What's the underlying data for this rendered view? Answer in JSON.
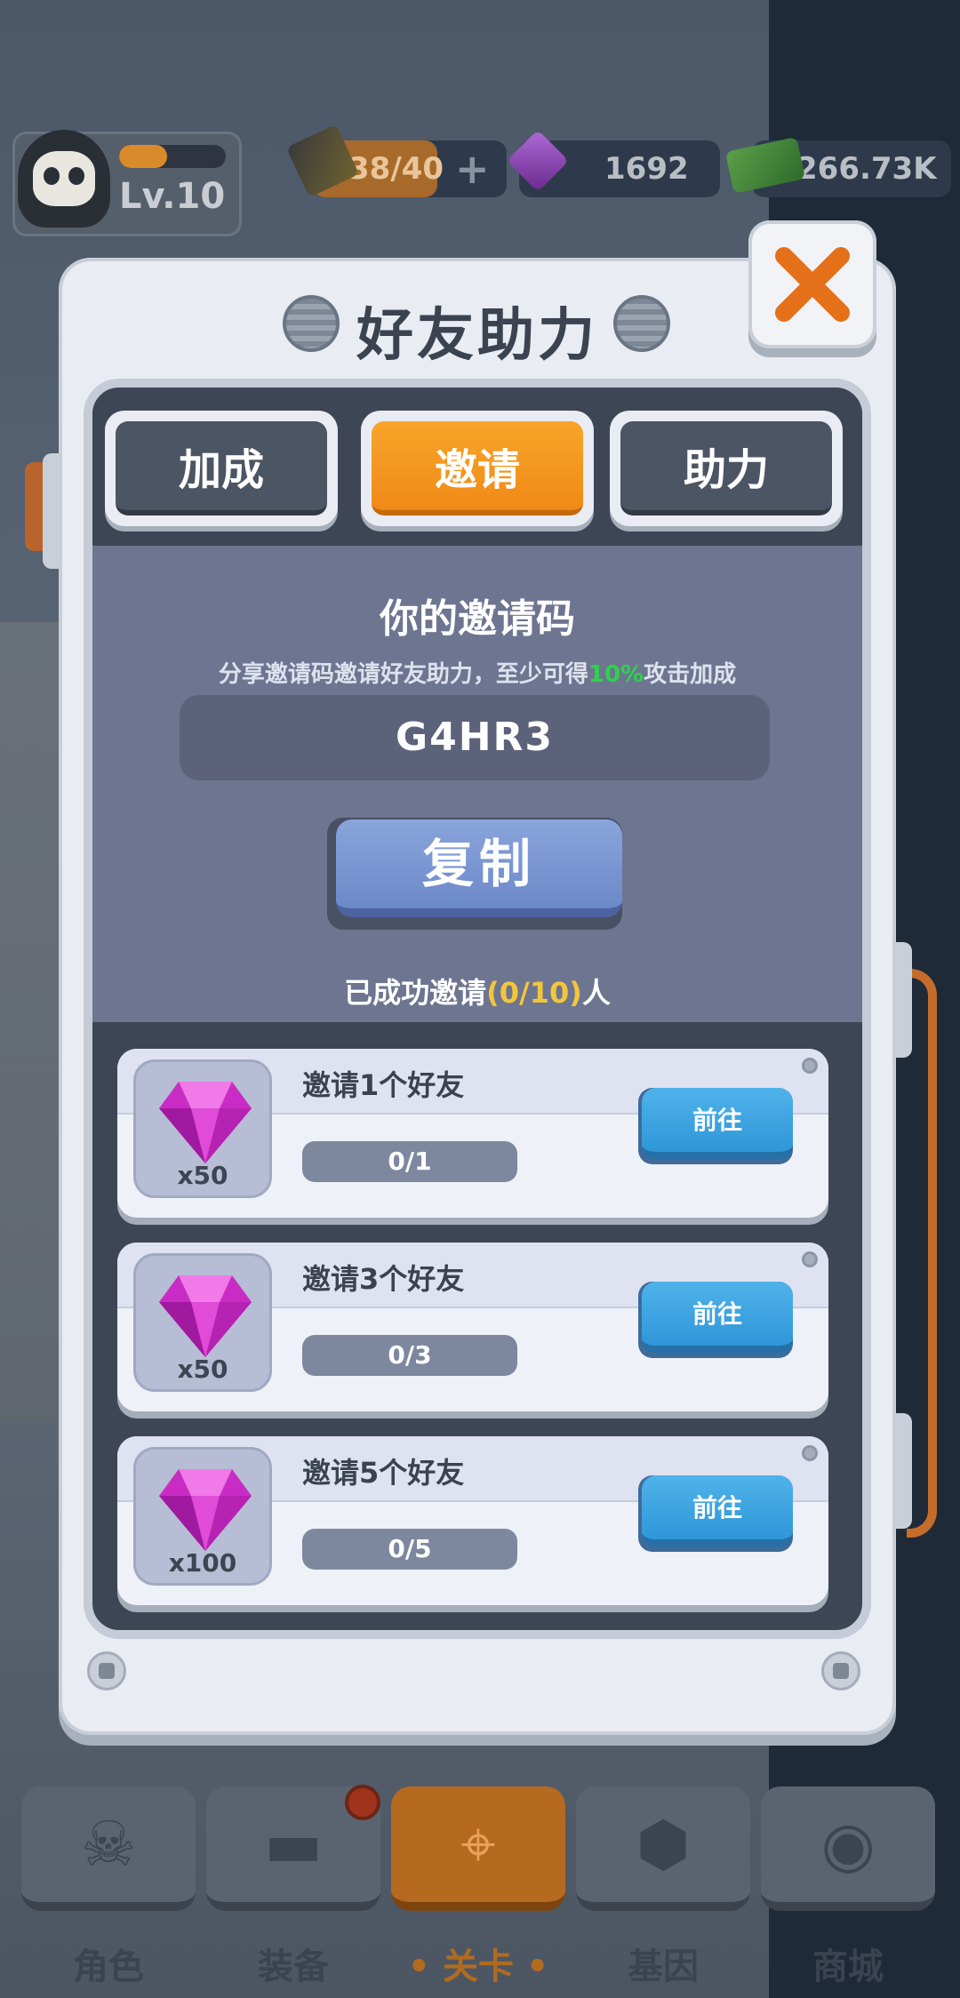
{
  "hud": {
    "level": "Lv.10",
    "xp_fraction": 0.45,
    "energy": "38/40",
    "plus": "+",
    "gems": "1692",
    "cash": "266.73K"
  },
  "modal": {
    "title": "好友助力",
    "tabs": [
      {
        "label": "加成",
        "active": false
      },
      {
        "label": "邀请",
        "active": true
      },
      {
        "label": "助力",
        "active": false
      }
    ],
    "invite_title": "你的邀请码",
    "invite_desc_pre": "分享邀请码邀请好友助力，至少可得",
    "invite_desc_highlight": "10%",
    "invite_desc_post": "攻击加成",
    "invite_code": "G4HR3",
    "copy_label": "复制",
    "invited_pre": "已成功邀请",
    "invited_count": "(0/10)",
    "invited_post": "人",
    "tasks": [
      {
        "title": "邀请1个好友",
        "reward": "x50",
        "progress": "0/1",
        "button": "前往"
      },
      {
        "title": "邀请3个好友",
        "reward": "x50",
        "progress": "0/3",
        "button": "前往"
      },
      {
        "title": "邀请5个好友",
        "reward": "x100",
        "progress": "0/5",
        "button": "前往"
      }
    ]
  },
  "bottom_nav": [
    {
      "label": "角色",
      "icon": "skull-icon",
      "active": false
    },
    {
      "label": "装备",
      "icon": "gun-icon",
      "active": false
    },
    {
      "label": "• 关卡 •",
      "icon": "map-pin-icon",
      "active": true
    },
    {
      "label": "基因",
      "icon": "hexagon-cluster-icon",
      "active": false
    },
    {
      "label": "商城",
      "icon": "shop-icon",
      "active": false
    }
  ],
  "colors": {
    "accent_orange": "#f08a16",
    "button_blue": "#2f97d8",
    "copy_blue": "#6c89c8",
    "highlight_green": "#2ed24a",
    "highlight_yellow": "#f3c63a",
    "close_orange": "#e5701a"
  }
}
